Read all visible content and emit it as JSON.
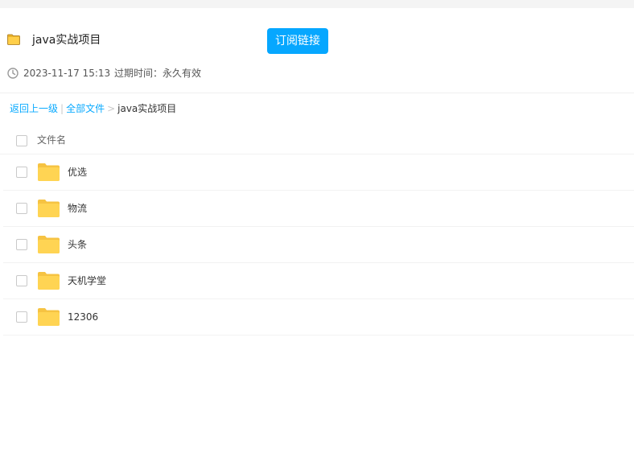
{
  "header": {
    "title": "java实战项目",
    "subscribe_label": "订阅链接",
    "accent_color": "#06a7ff"
  },
  "meta": {
    "date": "2023-11-17 15:13",
    "expire": "过期时间：永久有效",
    "icon": "clock-icon"
  },
  "breadcrumb": {
    "back": "返回上一级",
    "all_files": "全部文件",
    "current": "java实战项目",
    "sep1": "|",
    "sep2": ">"
  },
  "list": {
    "header": "文件名",
    "rows": [
      {
        "name": "优选",
        "icon": "folder-icon"
      },
      {
        "name": "物流",
        "icon": "folder-icon"
      },
      {
        "name": "头条",
        "icon": "folder-icon"
      },
      {
        "name": "天机学堂",
        "icon": "folder-icon"
      },
      {
        "name": "12306",
        "icon": "folder-icon"
      }
    ]
  },
  "colors": {
    "link": "#09aaff",
    "folder": "#ffd453"
  }
}
